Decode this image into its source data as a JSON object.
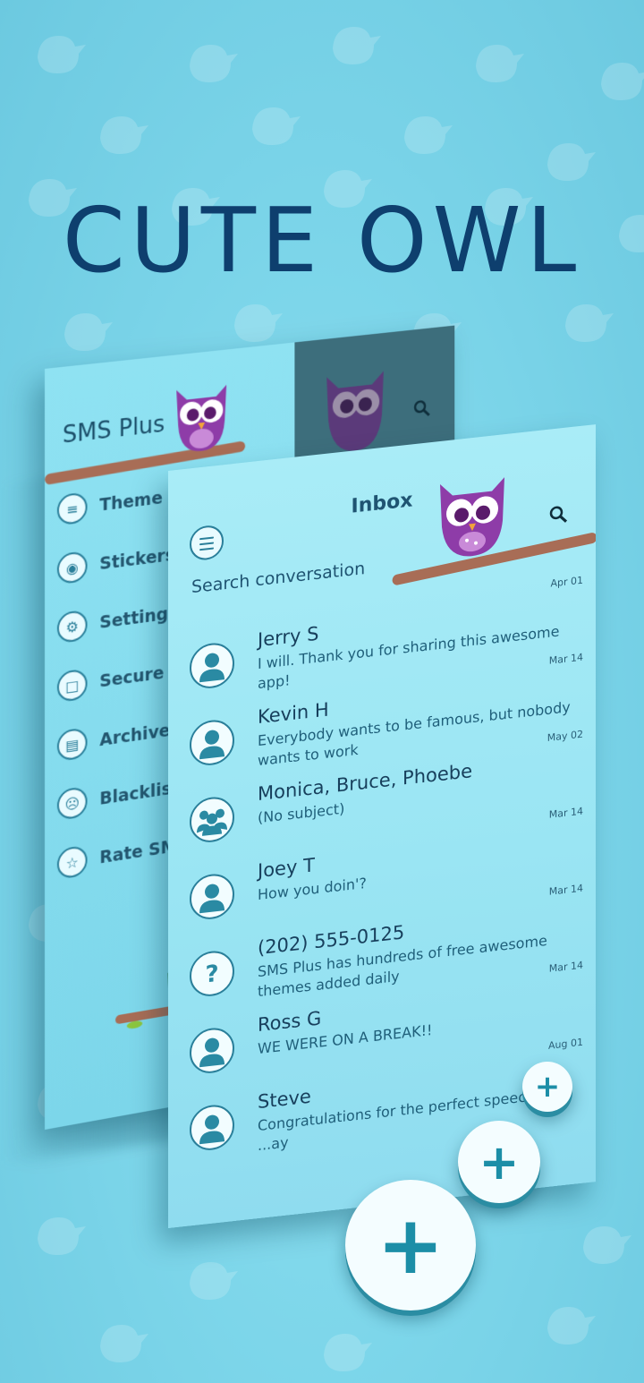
{
  "colors": {
    "background": "#7dd6ea",
    "title": "#0e3f6e",
    "accent": "#2a7f9a",
    "branch": "#a86d56",
    "owl": "#8e3ca8"
  },
  "title": "CUTE OWL",
  "drawer": {
    "app_name": "SMS Plus",
    "items": [
      {
        "label": "Theme Manager",
        "icon": "shirt-icon"
      },
      {
        "label": "Stickers",
        "icon": "owl-sticker-icon"
      },
      {
        "label": "Settings",
        "icon": "settings-icon"
      },
      {
        "label": "Secure",
        "icon": "lock-icon"
      },
      {
        "label": "Archive",
        "icon": "archive-icon"
      },
      {
        "label": "Blacklis",
        "icon": "blacklist-icon"
      },
      {
        "label": "Rate SM",
        "icon": "star-icon"
      }
    ]
  },
  "inbox": {
    "title": "Inbox",
    "search_placeholder": "Search conversation",
    "search_icon": "search-icon",
    "menu_icon": "hamburger-icon",
    "messages": [
      {
        "name": "Jerry S",
        "preview": "I will. Thank you for sharing this awesome app!",
        "date": "Apr 01",
        "avatar": "person-icon"
      },
      {
        "name": "Kevin H",
        "preview": "Everybody wants to be famous, but nobody wants to work",
        "date": "Mar 14",
        "avatar": "person-icon"
      },
      {
        "name": "Monica, Bruce, Phoebe",
        "preview": "(No subject)",
        "date": "May 02",
        "avatar": "group-icon"
      },
      {
        "name": "Joey T",
        "preview": "How you doin'?",
        "date": "Mar 14",
        "avatar": "person-icon"
      },
      {
        "name": "(202) 555-0125",
        "preview": "SMS Plus has hundreds of free awesome themes added daily",
        "date": "Mar 14",
        "avatar": "unknown-icon"
      },
      {
        "name": "Ross G",
        "preview": "WE WERE ON A BREAK!!",
        "date": "Mar 14",
        "avatar": "person-icon"
      },
      {
        "name": "Steve",
        "preview": "Congratulations for the perfect speech he ...ay",
        "date": "Aug 01",
        "avatar": "person-icon"
      }
    ]
  },
  "fab": {
    "symbol": "+"
  }
}
